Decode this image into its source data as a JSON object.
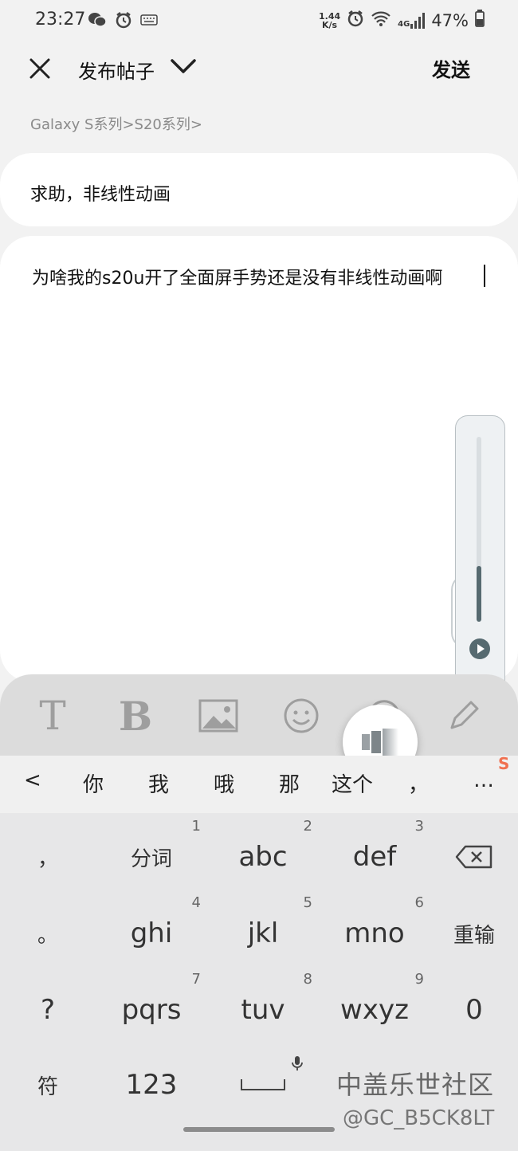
{
  "status_bar": {
    "time": "23:27",
    "net_speed_value": "1.44",
    "net_speed_unit": "K/s",
    "network_type": "4G",
    "battery": "47%"
  },
  "app_bar": {
    "title": "发布帖子",
    "send_label": "发送"
  },
  "breadcrumb": "Galaxy S系列>S20系列>",
  "post": {
    "title_value": "求助，非线性动画",
    "body_value": "为啥我的s20u开了全面屏手势还是没有非线性动画啊"
  },
  "toolbar": {
    "text_label": "T",
    "bold_label": "B"
  },
  "keyboard": {
    "back_label": "<",
    "candidates": [
      "你",
      "我",
      "哦",
      "那",
      "这个",
      "，"
    ],
    "more_label": "…",
    "rows": [
      [
        {
          "label": "，",
          "num": ""
        },
        {
          "label": "分词",
          "num": "1"
        },
        {
          "label": "abc",
          "num": "2"
        },
        {
          "label": "def",
          "num": "3"
        }
      ],
      [
        {
          "label": "。",
          "num": ""
        },
        {
          "label": "ghi",
          "num": "4"
        },
        {
          "label": "jkl",
          "num": "5"
        },
        {
          "label": "mno",
          "num": "6"
        },
        {
          "label": "重输",
          "num": ""
        }
      ],
      [
        {
          "label": "?",
          "num": ""
        },
        {
          "label": "pqrs",
          "num": "7"
        },
        {
          "label": "tuv",
          "num": "8"
        },
        {
          "label": "wxyz",
          "num": "9"
        },
        {
          "label": "0",
          "num": ""
        }
      ],
      [
        {
          "label": "符",
          "num": ""
        },
        {
          "label": "123",
          "num": ""
        }
      ]
    ]
  },
  "watermark": {
    "line1": "中盖乐世社区",
    "line2": "@GC_B5CK8LT"
  },
  "colors": {
    "background": "#f2f2f2",
    "card": "#ffffff",
    "toolbar": "#dcdcdc",
    "keyboard": "#e7e7e8",
    "accent_slider": "#566a70"
  }
}
